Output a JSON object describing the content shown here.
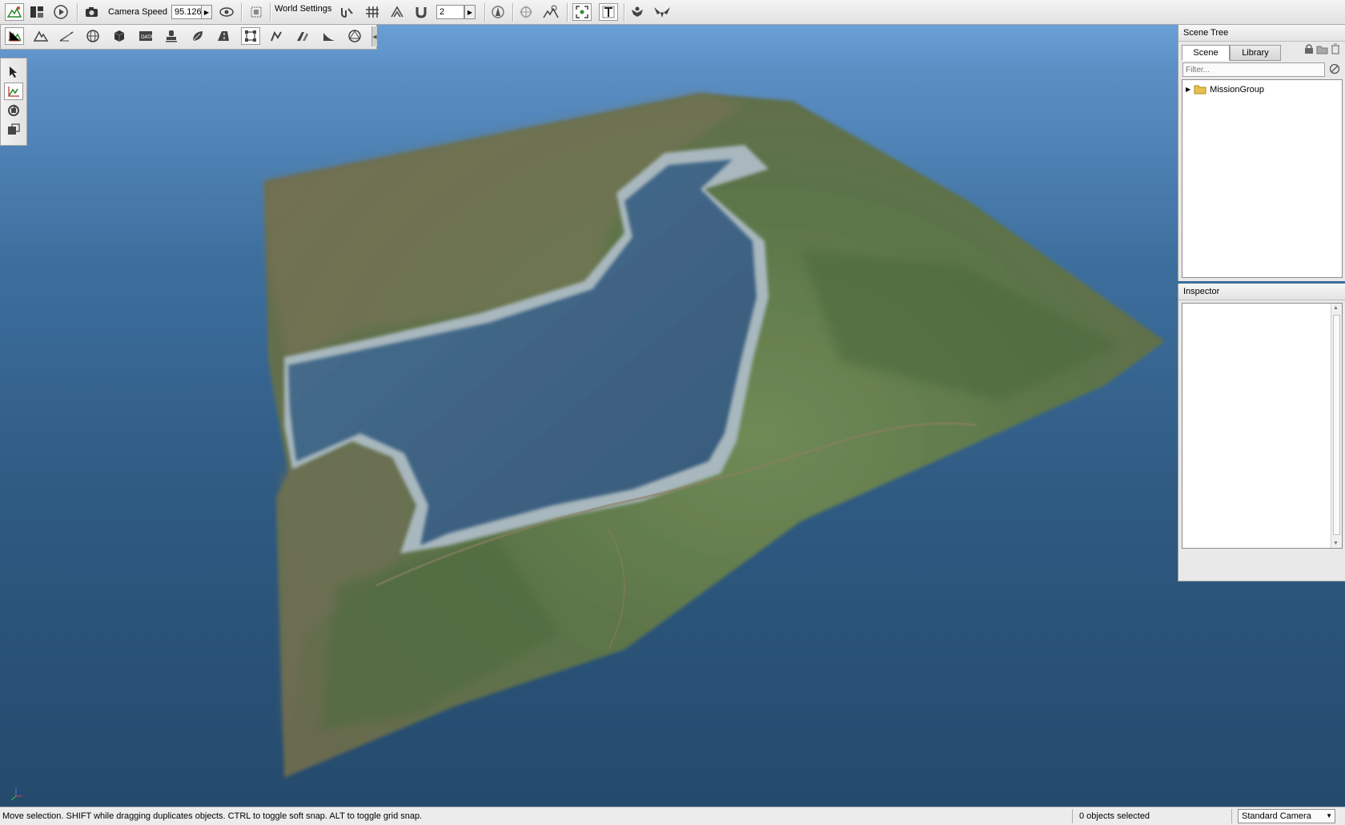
{
  "toolbar": {
    "camera_speed_label": "Camera Speed",
    "camera_speed_value": "95.126",
    "world_settings_label": "World Settings",
    "snap_value": "2"
  },
  "scene_tree": {
    "title": "Scene Tree",
    "tabs": [
      {
        "label": "Scene",
        "active": true
      },
      {
        "label": "Library",
        "active": false
      }
    ],
    "filter_placeholder": "Filter...",
    "items": [
      {
        "label": "MissionGroup",
        "expanded": false
      }
    ]
  },
  "inspector": {
    "title": "Inspector"
  },
  "status_bar": {
    "hint": "Move selection.  SHIFT while dragging duplicates objects.  CTRL to toggle soft snap.  ALT to toggle grid snap.",
    "selection_count": "0 objects selected",
    "camera_mode": "Standard Camera"
  },
  "colors": {
    "sky_blue": "#6a9fd6",
    "ocean_dark": "#244a6c",
    "terrain_green": "#5e7a4e",
    "lake_blue": "#3e6688"
  }
}
